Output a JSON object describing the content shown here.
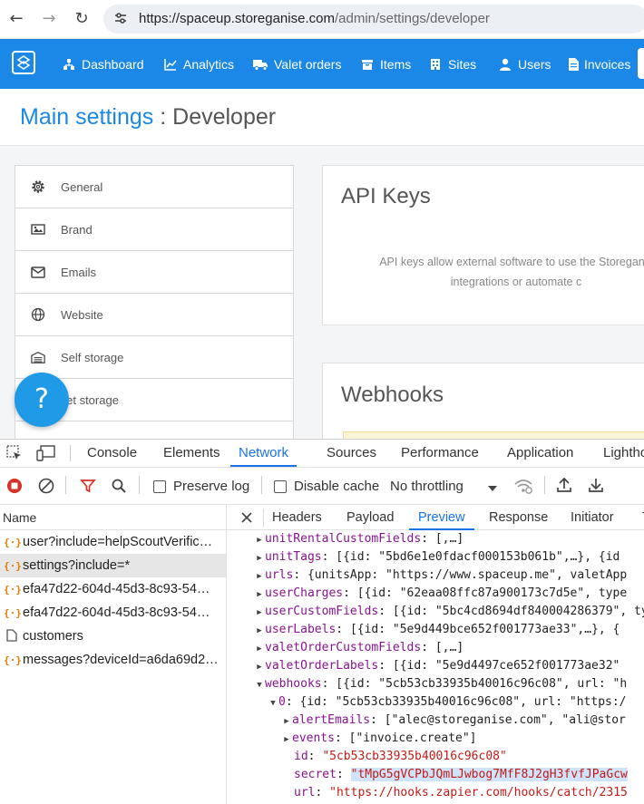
{
  "browser": {
    "url_host": "https://spaceup.storeganise.com",
    "url_path": "/admin/settings/developer",
    "icons": [
      "back-icon",
      "forward-icon",
      "reload-icon",
      "site-settings-icon"
    ]
  },
  "header": {
    "brand_color": "#1b87e6",
    "nav": [
      {
        "label": "Dashboard",
        "icon": "dashboard-icon"
      },
      {
        "label": "Analytics",
        "icon": "analytics-icon"
      },
      {
        "label": "Valet orders",
        "icon": "truck-icon"
      },
      {
        "label": "Items",
        "icon": "box-icon"
      },
      {
        "label": "Sites",
        "icon": "building-icon"
      },
      {
        "label": "Users",
        "icon": "user-icon"
      },
      {
        "label": "Invoices",
        "icon": "invoice-icon"
      }
    ]
  },
  "page": {
    "title_main": "Main settings",
    "title_sep": " : ",
    "title_sub": "Developer"
  },
  "menu": {
    "items": [
      {
        "label": "General",
        "icon": "gear-icon"
      },
      {
        "label": "Brand",
        "icon": "image-icon"
      },
      {
        "label": "Emails",
        "icon": "envelope-icon"
      },
      {
        "label": "Website",
        "icon": "globe-icon"
      },
      {
        "label": "Self storage",
        "icon": "warehouse-icon"
      },
      {
        "label": "alet storage",
        "icon": "valet-icon"
      }
    ]
  },
  "cards": {
    "apikeys_title": "API Keys",
    "apikeys_desc_1": "API keys allow external software to use the Storeganis",
    "apikeys_desc_2": "integrations or automate c",
    "webhooks_title": "Webhooks"
  },
  "help": {
    "label": "?"
  },
  "devtools": {
    "tabs": [
      "Console",
      "Elements",
      "Network",
      "Sources",
      "Performance",
      "Application",
      "Lightho"
    ],
    "active_tab": "Network",
    "toolbar": {
      "preserve_log": "Preserve log",
      "disable_cache": "Disable cache",
      "throttling": "No throttling"
    },
    "name_header": "Name",
    "requests": [
      {
        "name": "user?include=helpScoutVerific…",
        "type": "xhr"
      },
      {
        "name": "settings?include=*",
        "type": "xhr",
        "selected": true
      },
      {
        "name": "efa47d22-604d-45d3-8c93-54…",
        "type": "xhr"
      },
      {
        "name": "efa47d22-604d-45d3-8c93-54…",
        "type": "xhr"
      },
      {
        "name": "customers",
        "type": "doc"
      },
      {
        "name": "messages?deviceId=a6da69d2…",
        "type": "xhr"
      }
    ],
    "detail_tabs": [
      "Headers",
      "Payload",
      "Preview",
      "Response",
      "Initiator",
      "T"
    ],
    "active_detail_tab": "Preview",
    "preview": [
      {
        "key": "unitRentalCustomFields",
        "value": "[,…]"
      },
      {
        "key": "unitTags",
        "value": "[{id: \"5bd6e1e0fdacf000153b061b\",…}, {id"
      },
      {
        "key": "urls",
        "value": "{unitsApp: \"https://www.spaceup.me\", valetApp"
      },
      {
        "key": "userCharges",
        "value": "[{id: \"62eaa08ffc87a900173c7d5e\", type"
      },
      {
        "key": "userCustomFields",
        "value": "[{id: \"5bc4cd8694df840004286379\", type"
      },
      {
        "key": "userLabels",
        "value": "[{id: \"5e9d449bce652f001773ae33\",…}, {"
      },
      {
        "key": "valetOrderCustomFields",
        "value": "[,…]"
      },
      {
        "key": "valetOrderLabels",
        "value": "[{id: \"5e9d4497ce652f001773ae32\""
      },
      {
        "key": "webhooks",
        "value": "[{id: \"5cb53cb33935b40016c96c08\", url: \"h"
      },
      {
        "key": "0",
        "value": "{id: \"5cb53cb33935b40016c96c08\", url: \"https:/"
      },
      {
        "key": "alertEmails",
        "value": "[\"alec@storeganise.com\", \"ali@stor"
      },
      {
        "key": "events",
        "value": "[\"invoice.create\"]"
      },
      {
        "key": "id",
        "value": "\"5cb53cb33935b40016c96c08\""
      },
      {
        "key": "secret",
        "value": "\"tMpG5gVCPbJQmLJwbog7MfF8J2gH3fvfJPaGcw"
      },
      {
        "key": "url",
        "value": "\"https://hooks.zapier.com/hooks/catch/2315"
      }
    ]
  }
}
